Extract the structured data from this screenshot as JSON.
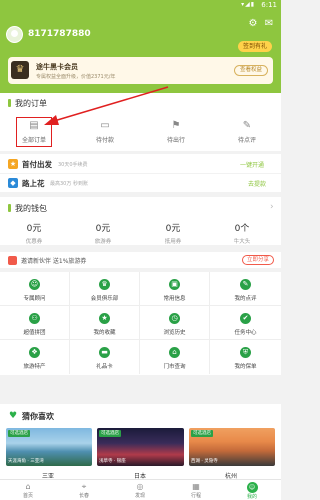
{
  "status_bar": {
    "time": "6:11",
    "signal": "▾◢▮"
  },
  "header": {
    "user_id": "8171787880",
    "settings_icon": "gear-icon",
    "message_icon": "message-icon",
    "signin_label": "签到有礼"
  },
  "vip": {
    "title": "途牛黑卡会员",
    "subtitle": "专属权益全面升级，价值2371元/年",
    "button": "查看权益"
  },
  "orders": {
    "title": "我的订单",
    "items": [
      {
        "label": "全部订单",
        "icon": "clipboard-icon"
      },
      {
        "label": "待付款",
        "icon": "wallet-icon"
      },
      {
        "label": "待出行",
        "icon": "flag-icon"
      },
      {
        "label": "待点评",
        "icon": "edit-icon"
      }
    ]
  },
  "shoufu": {
    "title": "首付出发",
    "sub": "30天0手续费",
    "action": "一键开通"
  },
  "lushanghua": {
    "title": "路上花",
    "sub": "最高30万 秒到账",
    "action": "去提款"
  },
  "wallet": {
    "title": "我的钱包",
    "items": [
      {
        "num": "0元",
        "label": "优惠券"
      },
      {
        "num": "0元",
        "label": "旅游券"
      },
      {
        "num": "0元",
        "label": "抵用券"
      },
      {
        "num": "0个",
        "label": "牛大头"
      }
    ]
  },
  "invite": {
    "text": "邀请新伙伴 送1%旅游券",
    "button": "立即分享"
  },
  "services": [
    {
      "label": "专属顾问",
      "icon": "advisor-icon"
    },
    {
      "label": "会员俱乐部",
      "icon": "crown-icon"
    },
    {
      "label": "常用信息",
      "icon": "id-card-icon"
    },
    {
      "label": "我的点评",
      "icon": "comment-icon"
    },
    {
      "label": "超值拼团",
      "icon": "group-icon"
    },
    {
      "label": "我的收藏",
      "icon": "star-icon"
    },
    {
      "label": "浏览历史",
      "icon": "history-icon"
    },
    {
      "label": "任务中心",
      "icon": "task-icon"
    },
    {
      "label": "旅游特产",
      "icon": "gift-icon"
    },
    {
      "label": "礼品卡",
      "icon": "card-icon"
    },
    {
      "label": "门市查询",
      "icon": "store-icon"
    },
    {
      "label": "我的保单",
      "icon": "insurance-icon"
    }
  ],
  "favorites": {
    "title": "猜你喜欢",
    "photos": [
      {
        "tag": "可选酒店",
        "caption": "天涯海角 · 三亚湾",
        "city": "三亚"
      },
      {
        "tag": "可选酒店",
        "caption": "浅草寺 · 银座",
        "city": "日本"
      },
      {
        "tag": "可选酒店",
        "caption": "西湖 · 灵隐寺",
        "city": "杭州"
      }
    ]
  },
  "nav": [
    {
      "label": "首页",
      "icon": "home-icon"
    },
    {
      "label": "长春",
      "icon": "location-icon"
    },
    {
      "label": "发现",
      "icon": "compass-icon"
    },
    {
      "label": "行程",
      "icon": "calendar-icon"
    },
    {
      "label": "我的",
      "icon": "user-icon"
    }
  ],
  "colors": {
    "brand_green": "#8ec63f",
    "accent_red": "#e02020",
    "nav_active": "#2bb04a"
  }
}
